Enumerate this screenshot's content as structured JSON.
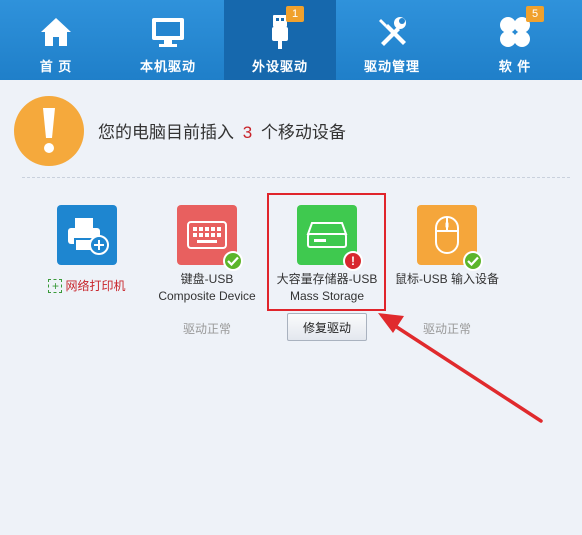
{
  "nav": {
    "items": [
      {
        "label": "首 页",
        "icon": "home-icon"
      },
      {
        "label": "本机驱动",
        "icon": "monitor-icon"
      },
      {
        "label": "外设驱动",
        "icon": "usb-icon",
        "badge": "1",
        "active": true
      },
      {
        "label": "驱动管理",
        "icon": "tools-icon"
      },
      {
        "label": "软 件",
        "icon": "software-icon",
        "badge": "5"
      }
    ]
  },
  "banner": {
    "prefix": "您的电脑目前插入",
    "count": "3",
    "suffix": "个移动设备"
  },
  "devices": {
    "printer": {
      "link_label": "网络打印机",
      "plus": "+",
      "color": "#1e86d0"
    },
    "keyboard": {
      "line1": "键盘-USB",
      "line2": "Composite Device",
      "status": "驱动正常",
      "color": "#e8605f"
    },
    "storage": {
      "line1": "大容量存储器-USB",
      "line2": "Mass Storage",
      "error_mark": "!",
      "action": "修复驱动",
      "color": "#3fc94f"
    },
    "mouse": {
      "line1": "鼠标-USB 输入设备",
      "status": "驱动正常",
      "color": "#f5a63b"
    }
  },
  "colors": {
    "nav_bg": "#2a8bd6",
    "nav_active": "#1668ad",
    "badge": "#f0a12d",
    "warning": "#f5a93c",
    "count_red": "#c8242a",
    "highlight_red": "#e0242b",
    "ok_green": "#5cb52b"
  }
}
